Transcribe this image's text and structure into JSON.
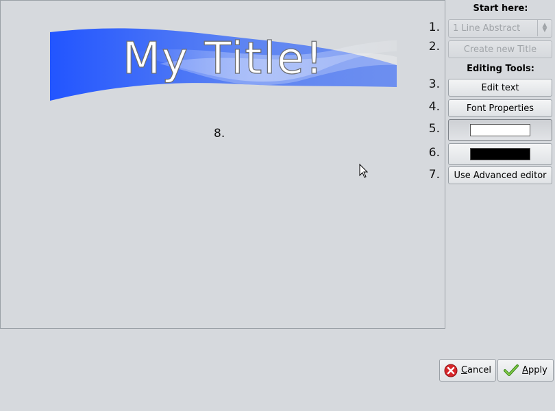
{
  "preview": {
    "title_text": "My Title!",
    "marker": "8.",
    "banner_color": "#2255ff"
  },
  "panel": {
    "start_heading": "Start here:",
    "editing_heading": "Editing Tools:",
    "template_combo": "1 Line Abstract",
    "create_button": "Create new Title",
    "edit_text_button": "Edit text",
    "font_properties_button": "Font Properties",
    "advanced_editor_button": "Use Advanced editor",
    "text_color": "#ffffff",
    "outline_color": "#000000",
    "numbers": [
      "1.",
      "2.",
      "3.",
      "4.",
      "5.",
      "6.",
      "7."
    ]
  },
  "footer": {
    "cancel_first": "C",
    "cancel_rest": "ancel",
    "apply_first": "A",
    "apply_rest": "pply",
    "cancel_icon": "cancel-icon",
    "apply_icon": "checkmark-icon"
  }
}
